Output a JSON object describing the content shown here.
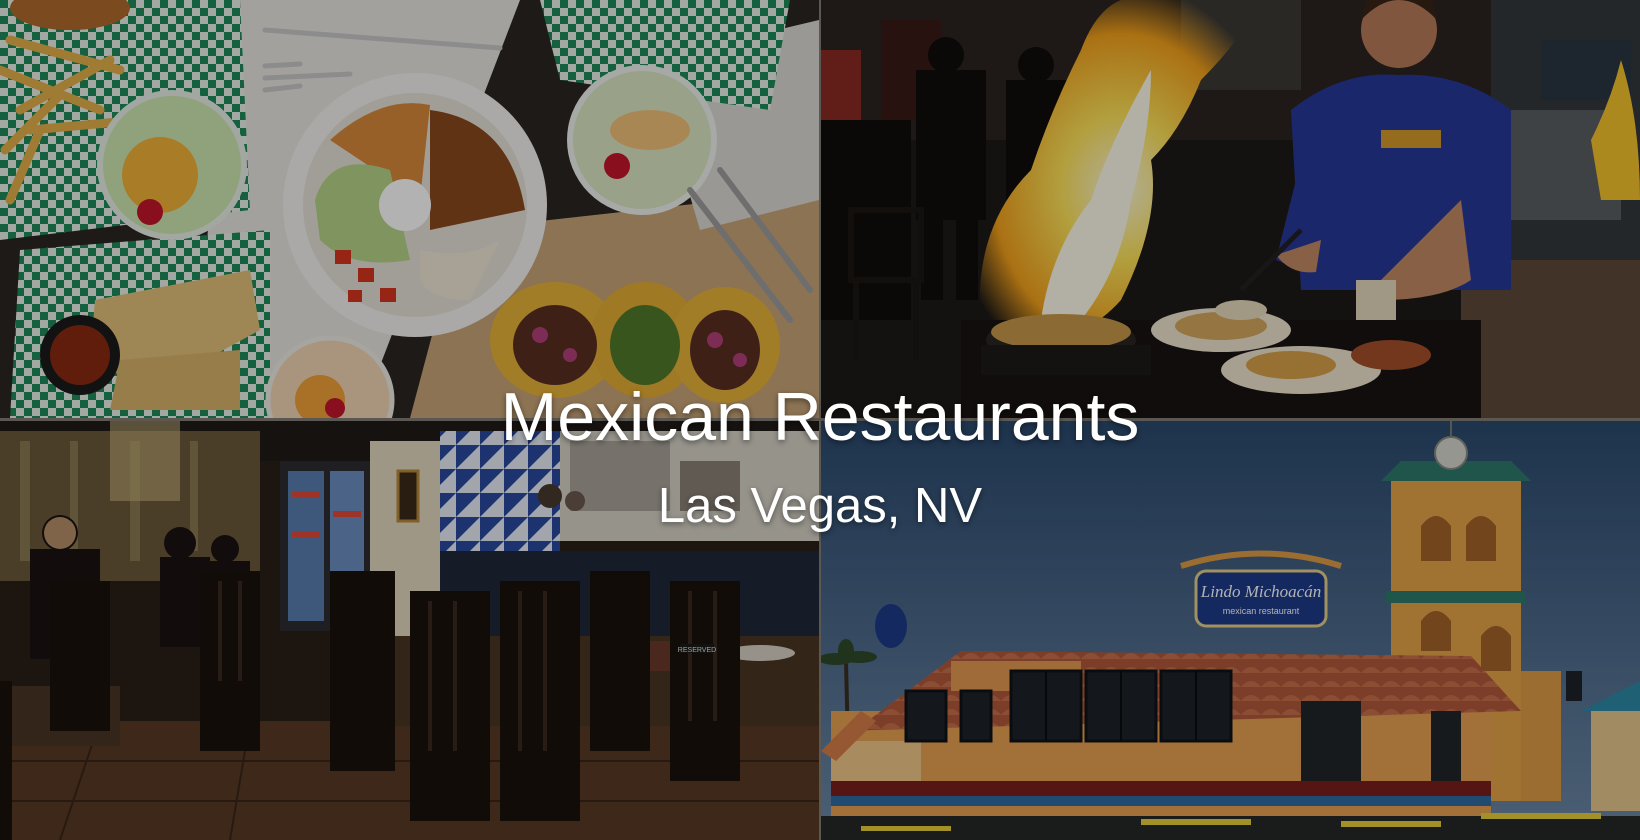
{
  "headline": "Mexican Restaurants",
  "location": "Las Vegas, NV",
  "building_sign": "Lindo Michoacán",
  "building_sign_sub": "mexican restaurant",
  "table_sign": "RESERVED",
  "photos": [
    {
      "subject": "overhead food spread",
      "subject_icon": "tacos-plate-photo"
    },
    {
      "subject": "flambe tableside",
      "subject_icon": "flambe-photo"
    },
    {
      "subject": "restaurant dining room",
      "subject_icon": "dining-room-photo"
    },
    {
      "subject": "restaurant exterior",
      "subject_icon": "building-photo"
    }
  ],
  "colors": {
    "title": "#ffffff",
    "overlay": "rgba(0,0,0,0.30)",
    "sign_blue": "#1f3b8c",
    "roof_tile": "#b45a3c",
    "flame": "#ffd23a"
  }
}
